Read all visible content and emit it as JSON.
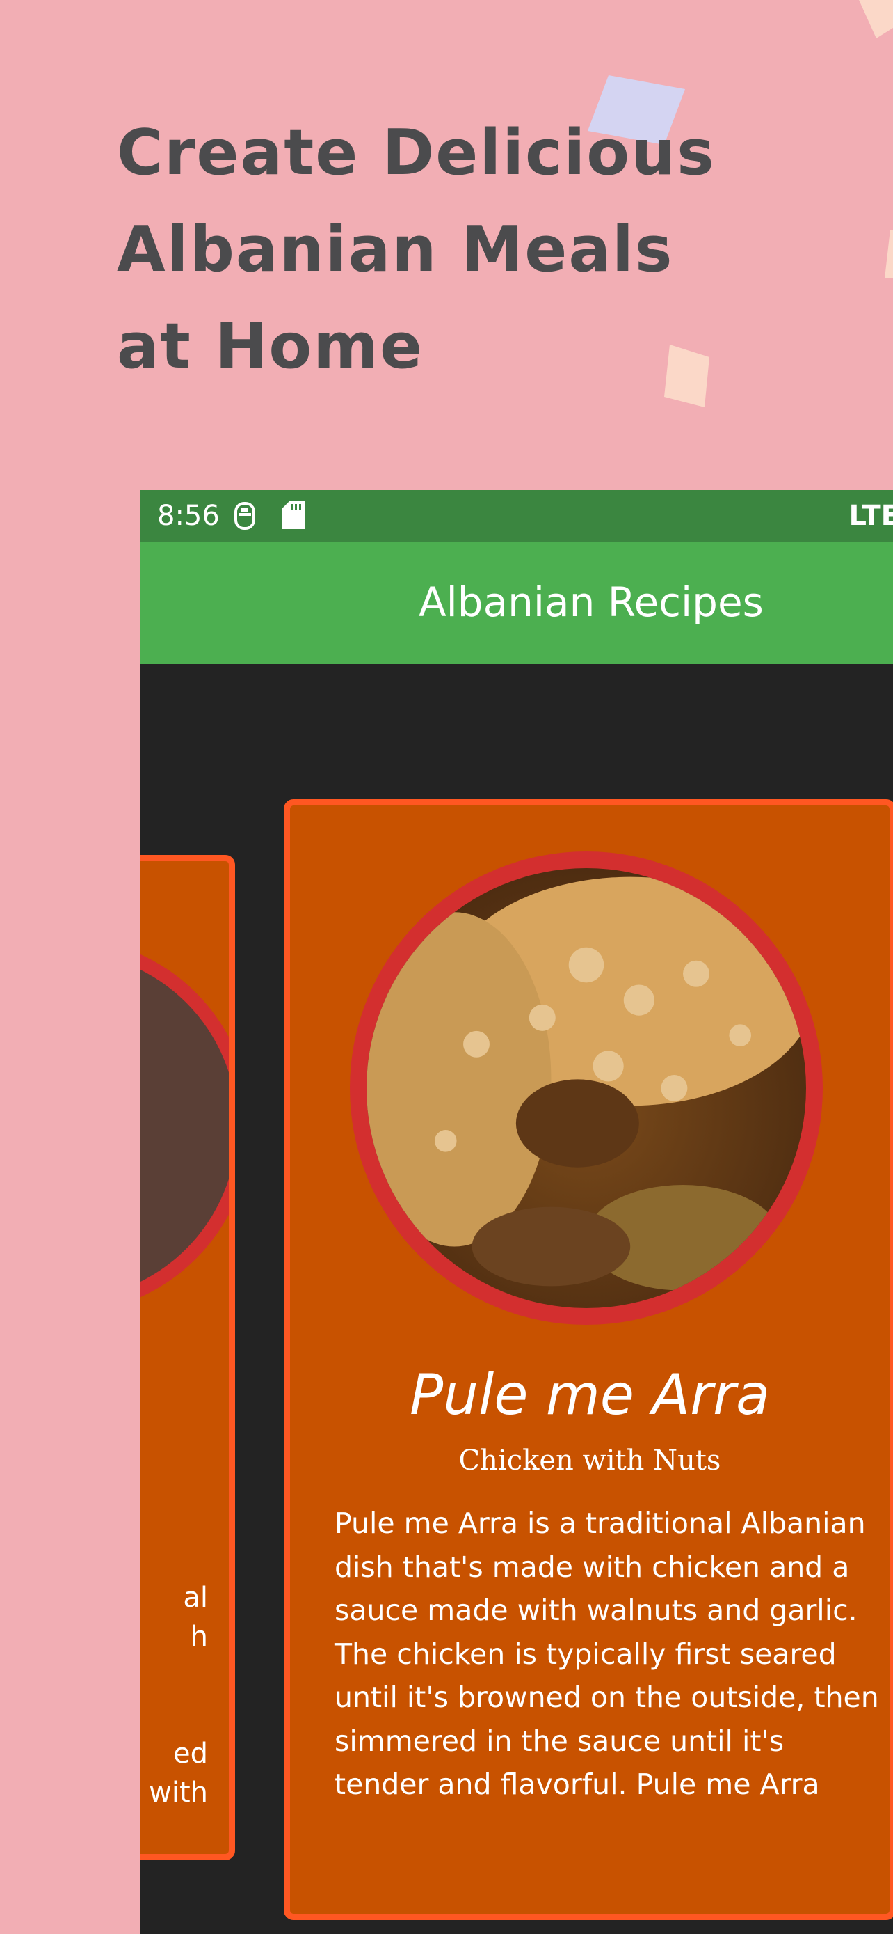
{
  "headline": {
    "line1": "Create Delicious",
    "line2": "Albanian Meals",
    "line3": "at Home"
  },
  "status_bar": {
    "time": "8:56",
    "icons": [
      "sim-icon",
      "sd-card-icon"
    ],
    "network": "LTE"
  },
  "app_bar": {
    "title": "Albanian Recipes",
    "color": "#4caf50"
  },
  "cards": [
    {
      "name": "Pule me Arra",
      "subtitle": "Chicken with Nuts",
      "description": "Pule me Arra is a traditional Albanian dish that's made with chicken and a sauce made with walnuts and garlic. The chicken is typically first seared until it's browned on the outside, then simmered in the sauce until it's tender and flavorful. Pule me Arra"
    }
  ],
  "side_card": {
    "text_fragment": "al\nh\n\n\ned\nwith"
  },
  "colors": {
    "background": "#f2aeb4",
    "card": "#c85200",
    "card_border": "#ff5722",
    "image_ring": "#d32f2f",
    "screen": "#232323",
    "status_bar": "#3b8640"
  }
}
